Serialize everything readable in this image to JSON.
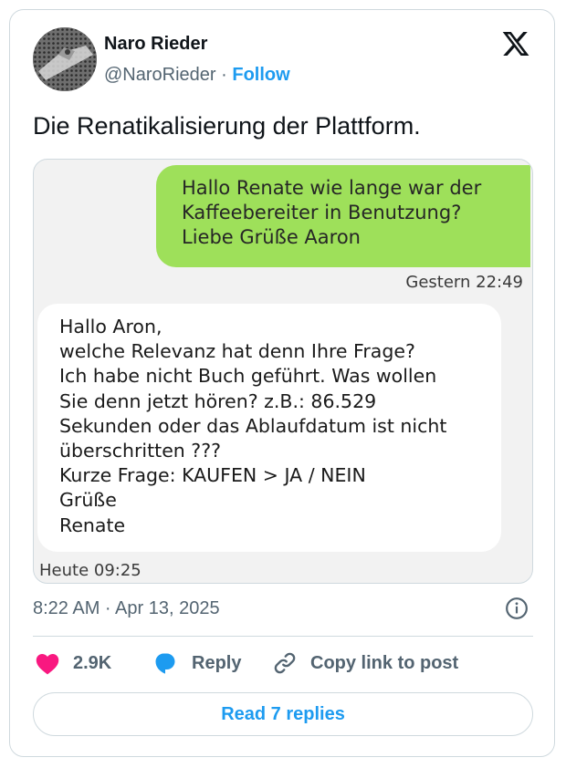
{
  "author": {
    "name": "Naro Rieder",
    "handle": "@NaroRieder",
    "separator": " · ",
    "follow_label": "Follow"
  },
  "tweet": {
    "text": "Die Renatikalisierung der Plattform.",
    "timestamp": "8:22 AM · Apr 13, 2025"
  },
  "chat": {
    "outgoing": {
      "lines": [
        "Hallo Renate wie lange war der",
        "Kaffeebereiter in Benutzung?",
        "Liebe Grüße Aaron"
      ],
      "time": "Gestern 22:49",
      "bubble_color": "#9ee05a"
    },
    "incoming": {
      "lines": [
        "Hallo Aron,",
        "welche Relevanz hat denn Ihre Frage?",
        "Ich habe nicht Buch geführt. Was wollen",
        "Sie denn jetzt hören? z.B.: 86.529",
        "Sekunden oder das Ablaufdatum ist nicht",
        "überschritten ???",
        "Kurze Frage: KAUFEN > JA / NEIN",
        "Grüße",
        "Renate"
      ],
      "time": "Heute 09:25"
    }
  },
  "actions": {
    "like_count": "2.9K",
    "reply_label": "Reply",
    "copy_link_label": "Copy link to post"
  },
  "replies_button": "Read 7 replies",
  "icons": {
    "logo": "x-logo-icon",
    "info": "info-icon",
    "like": "heart-icon",
    "reply": "reply-bubble-icon",
    "copy": "link-icon"
  },
  "colors": {
    "accent": "#1d9bf0",
    "like": "#f91880",
    "muted": "#536471",
    "border": "#cfd9de"
  }
}
